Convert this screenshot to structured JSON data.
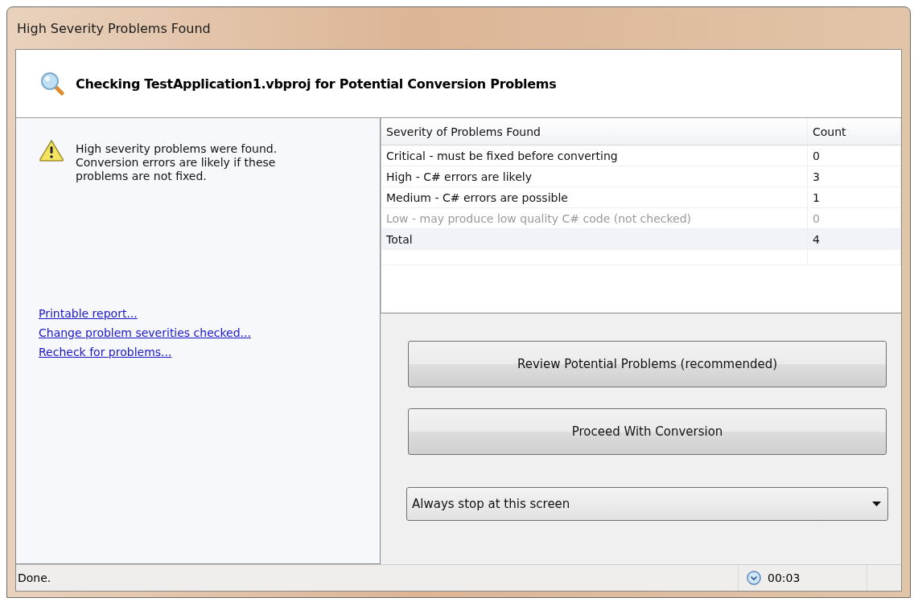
{
  "window": {
    "title": "High Severity Problems Found"
  },
  "header": {
    "title": "Checking TestApplication1.vbproj for Potential Conversion Problems"
  },
  "message": "High severity problems were found.  Conversion errors are likely if these problems are not fixed.",
  "links": [
    "Printable report...",
    "Change problem severities checked...",
    "Recheck for problems..."
  ],
  "table": {
    "columns": [
      "Severity of Problems Found",
      "Count"
    ],
    "rows": [
      {
        "severity": "Critical - must be fixed before converting",
        "count": "0",
        "disabled": false
      },
      {
        "severity": "High - C# errors are likely",
        "count": "3",
        "disabled": false
      },
      {
        "severity": "Medium - C# errors are possible",
        "count": "1",
        "disabled": false
      },
      {
        "severity": "Low - may produce low quality C# code (not checked)",
        "count": "0",
        "disabled": true
      }
    ],
    "total": {
      "label": "Total",
      "count": "4"
    }
  },
  "buttons": [
    "Review Potential Problems (recommended)",
    "Proceed With Conversion"
  ],
  "dropdown": {
    "value": "Always stop at this screen"
  },
  "status_bar": {
    "text": "Done.",
    "elapsed": "00:03"
  }
}
